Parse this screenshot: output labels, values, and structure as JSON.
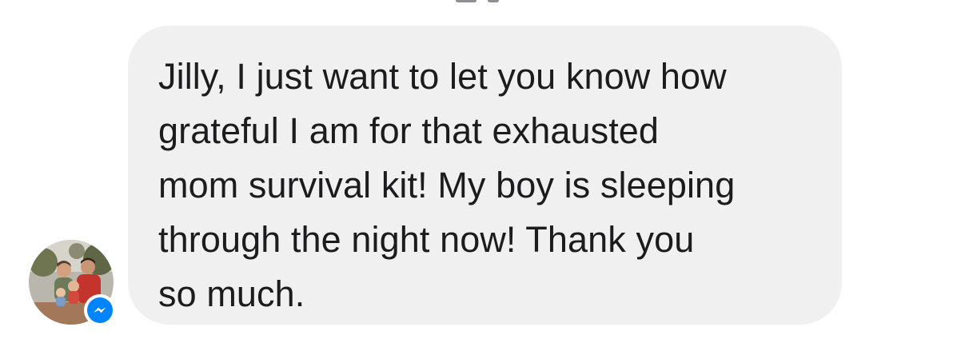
{
  "conversation": {
    "message": {
      "text": "Jilly, I just want to let you know how grateful I am for that exhausted mom survival kit! My boy is sleeping through the night now! Thank you so much.",
      "lines": [
        "Jilly, I just want to let you know how",
        "grateful I am for that exhausted",
        "mom survival kit! My boy is sleeping",
        "through the night now! Thank you",
        "so much."
      ]
    },
    "sender": {
      "avatar_icon": "profile-photo",
      "badge_icon": "messenger-icon"
    }
  },
  "colors": {
    "bubble_background": "#f0f0f0",
    "text": "#1c1c1e",
    "messenger_blue": "#0084ff",
    "page_background": "#ffffff"
  }
}
